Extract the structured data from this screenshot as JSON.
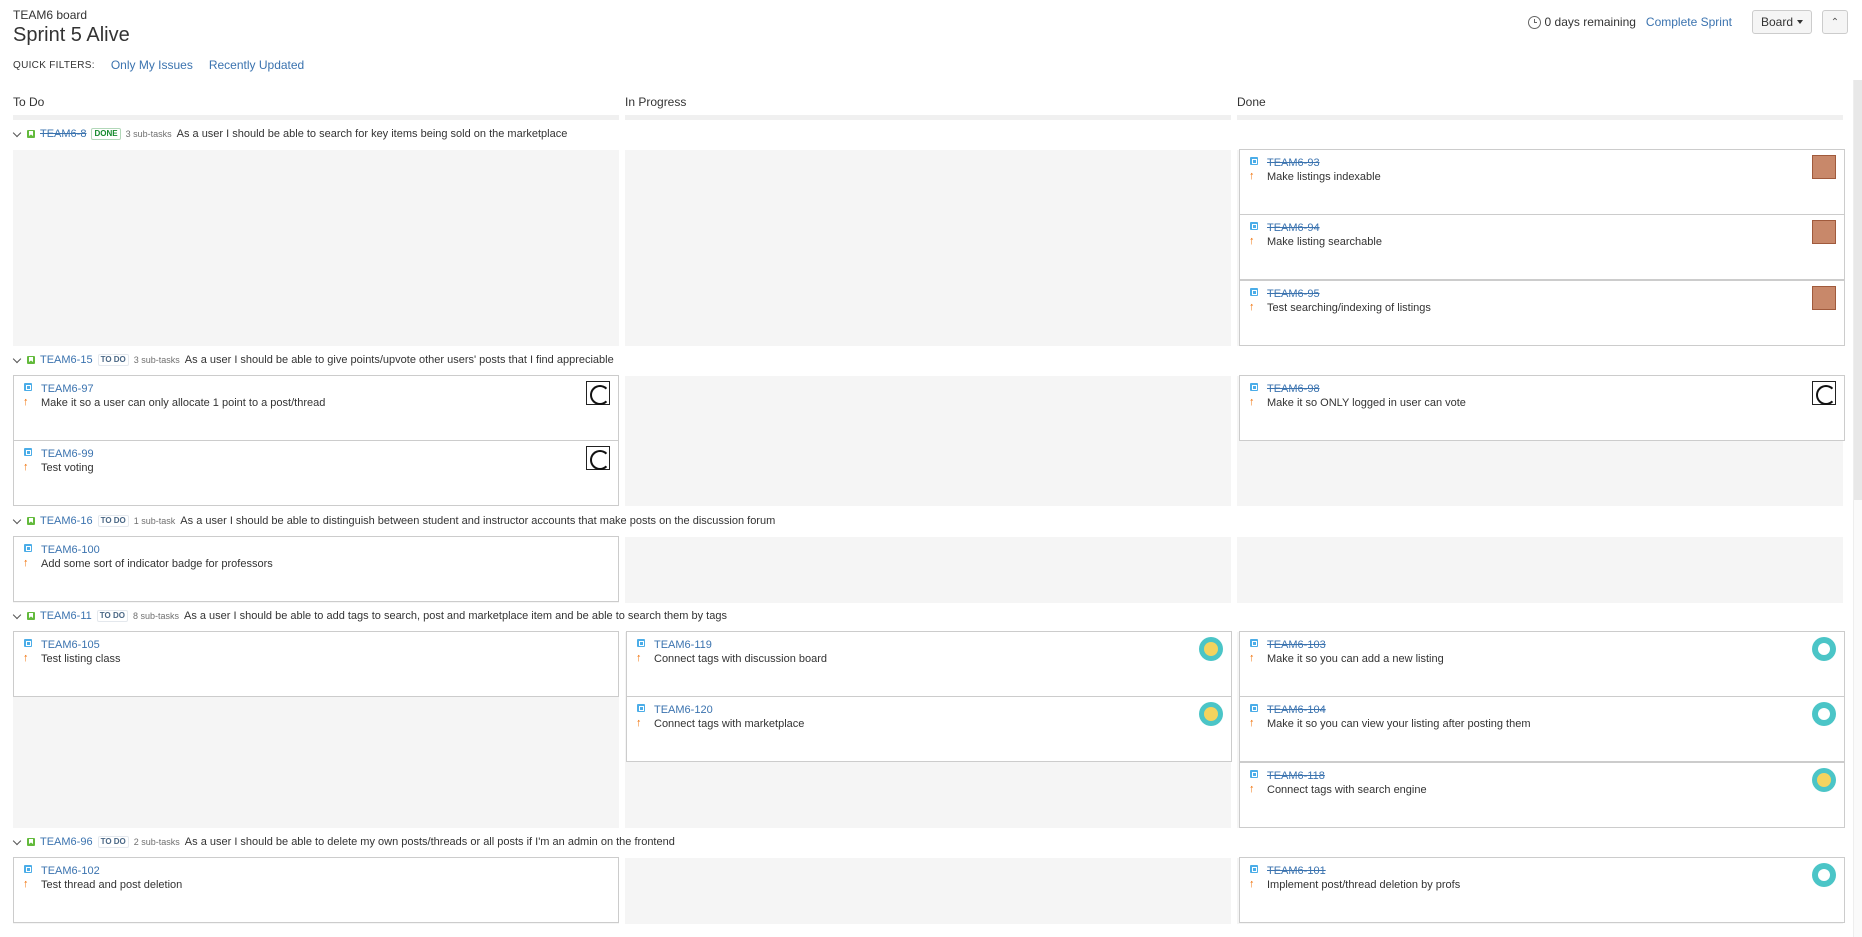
{
  "header": {
    "board_label": "TEAM6 board",
    "sprint_title": "Sprint 5 Alive",
    "remaining": "0 days remaining",
    "complete_sprint": "Complete Sprint",
    "board_button": "Board",
    "collapse_icon": "double-chevron-up-icon"
  },
  "quick_filters": {
    "label": "QUICK FILTERS:",
    "items": [
      "Only My Issues",
      "Recently Updated"
    ]
  },
  "columns": [
    "To Do",
    "In Progress",
    "Done"
  ],
  "swimlanes": [
    {
      "key": "TEAM6-8",
      "status": "DONE",
      "subtasks": "3 sub-tasks",
      "summary": "As a user I should be able to search for key items being sold on the marketplace"
    },
    {
      "key": "TEAM6-15",
      "status": "TO DO",
      "subtasks": "3 sub-tasks",
      "summary": "As a user I should be able to give points/upvote other users' posts that I find appreciable"
    },
    {
      "key": "TEAM6-16",
      "status": "TO DO",
      "subtasks": "1 sub-task",
      "summary": "As a user I should be able to distinguish between student and instructor accounts that make posts on the discussion forum"
    },
    {
      "key": "TEAM6-11",
      "status": "TO DO",
      "subtasks": "8 sub-tasks",
      "summary": "As a user I should be able to add tags to search, post and marketplace item and be able to search them by tags"
    },
    {
      "key": "TEAM6-96",
      "status": "TO DO",
      "subtasks": "2 sub-tasks",
      "summary": "As a user I should be able to delete my own posts/threads or all posts if I'm an admin on the frontend"
    }
  ],
  "cards": [
    {
      "key": "TEAM6-93",
      "summary": "Make listings indexable",
      "avatar": "photo-avatar"
    },
    {
      "key": "TEAM6-94",
      "summary": "Make listing searchable",
      "avatar": "photo-avatar"
    },
    {
      "key": "TEAM6-95",
      "summary": "Test searching/indexing of listings",
      "avatar": "photo-avatar"
    },
    {
      "key": "TEAM6-97",
      "summary": "Make it so a user can only allocate 1 point to a post/thread",
      "avatar": "sketch-avatar"
    },
    {
      "key": "TEAM6-99",
      "summary": "Test voting",
      "avatar": "sketch-avatar"
    },
    {
      "key": "TEAM6-98",
      "summary": "Make it so ONLY logged in user can vote",
      "avatar": "sketch-avatar"
    },
    {
      "key": "TEAM6-100",
      "summary": "Add some sort of indicator badge for professors",
      "avatar": ""
    },
    {
      "key": "TEAM6-105",
      "summary": "Test listing class",
      "avatar": ""
    },
    {
      "key": "TEAM6-119",
      "summary": "Connect tags with discussion board",
      "avatar": "dog-avatar"
    },
    {
      "key": "TEAM6-120",
      "summary": "Connect tags with marketplace",
      "avatar": "dog-avatar"
    },
    {
      "key": "TEAM6-103",
      "summary": "Make it so you can add a new listing",
      "avatar": "teal-avatar"
    },
    {
      "key": "TEAM6-104",
      "summary": "Make it so you can view your listing after posting them",
      "avatar": "teal-avatar"
    },
    {
      "key": "TEAM6-118",
      "summary": "Connect tags with search engine",
      "avatar": "dog-avatar"
    },
    {
      "key": "TEAM6-102",
      "summary": "Test thread and post deletion",
      "avatar": ""
    },
    {
      "key": "TEAM6-101",
      "summary": "Implement post/thread deletion by profs",
      "avatar": "teal-avatar"
    }
  ],
  "colors": {
    "link": "#3b73af",
    "done_status": "#14892c",
    "story_icon": "#63ba3c",
    "subtask_icon": "#4bade8",
    "priority_arrow": "#f06d00",
    "cell_background": "#f5f5f5"
  }
}
